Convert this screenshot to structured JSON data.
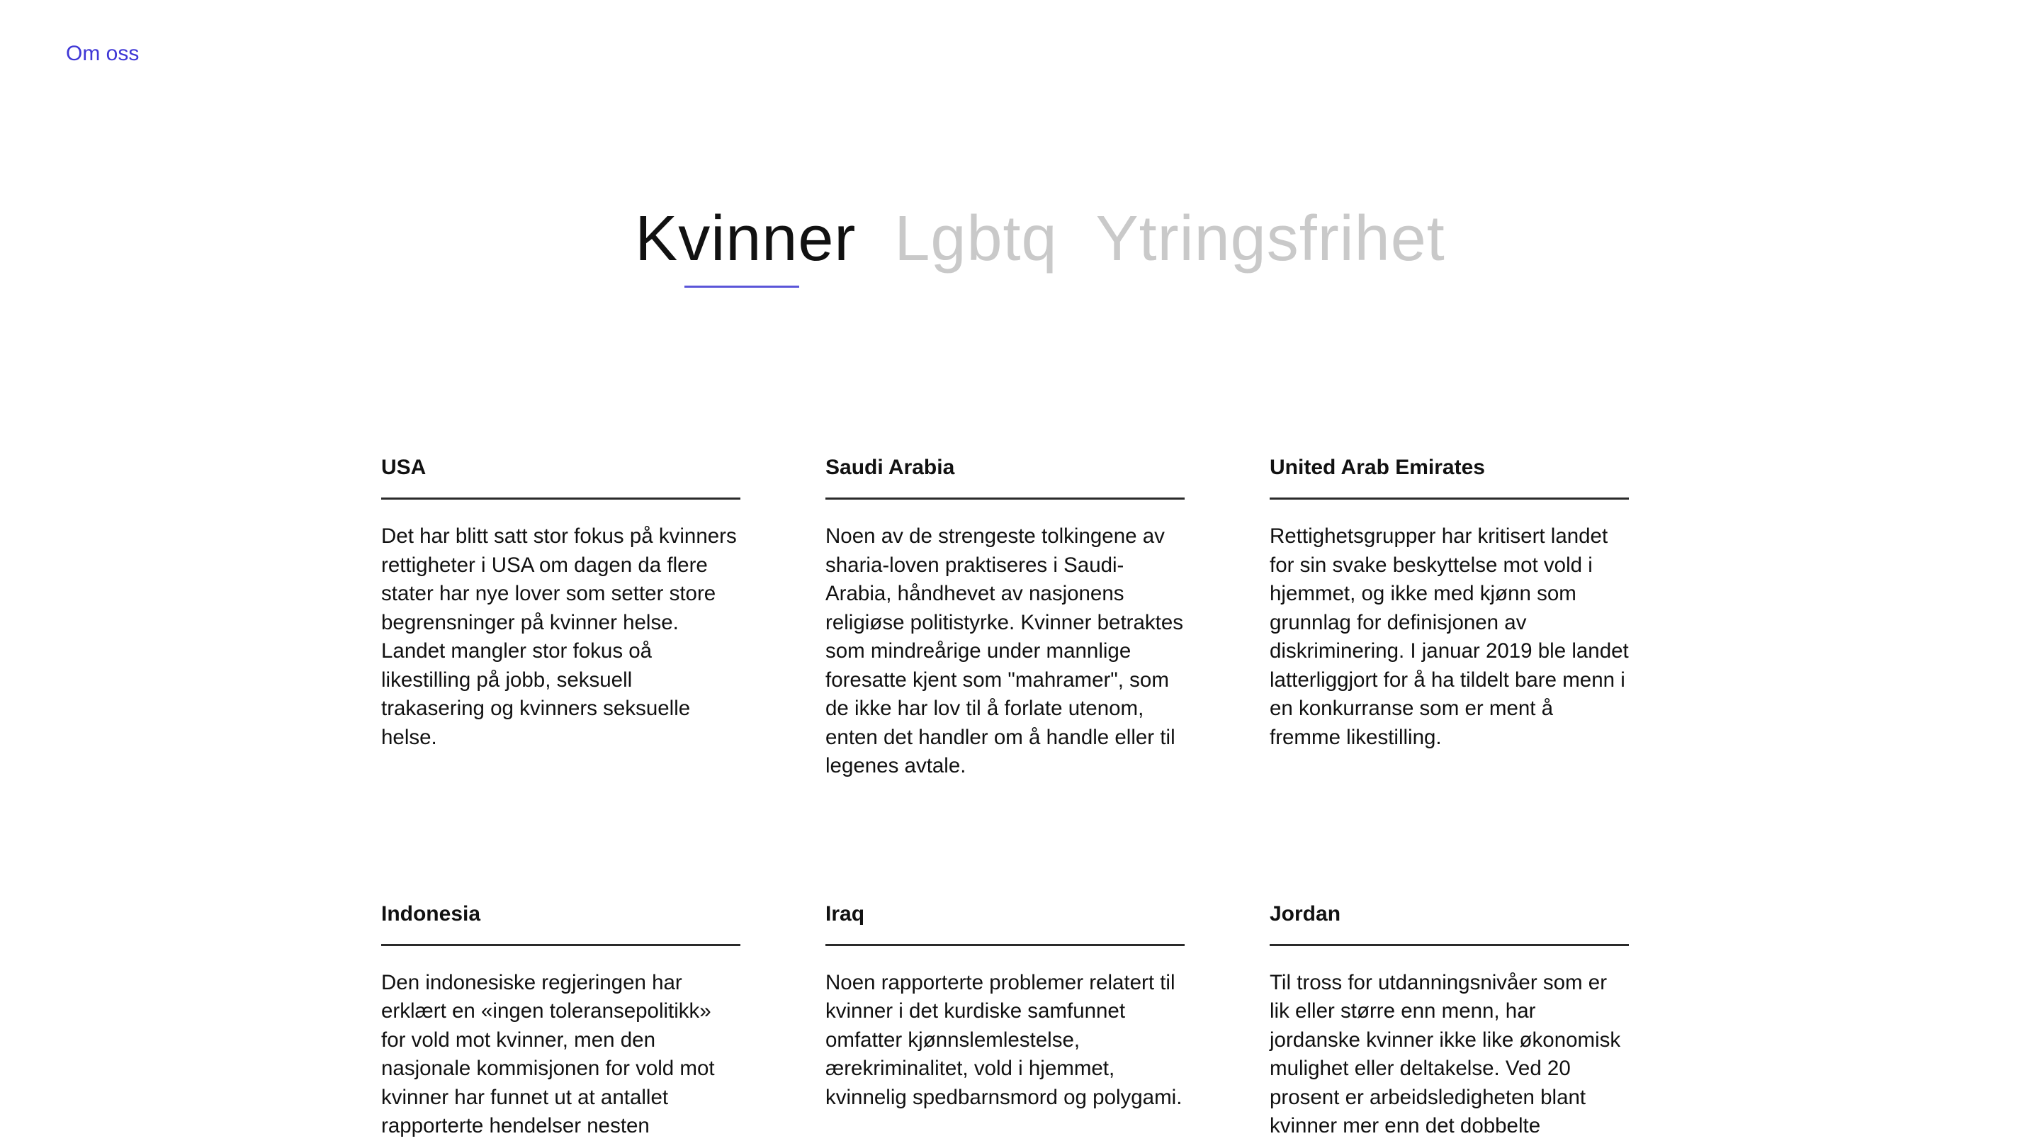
{
  "nav": {
    "about_link": "Om oss"
  },
  "tabs": [
    {
      "label": "Kvinner",
      "active": true
    },
    {
      "label": "Lgbtq",
      "active": false
    },
    {
      "label": "Ytringsfrihet",
      "active": false
    }
  ],
  "colors": {
    "accent": "#3f37d6",
    "underline": "#5a55d8",
    "inactive_tab": "#c9c9c9",
    "text": "#111111"
  },
  "countries": [
    {
      "name": "USA",
      "text": "Det har blitt satt stor fokus på kvinners rettigheter i USA om dagen da flere stater har nye lover som setter store begrensninger på kvinner helse. Landet mangler stor fokus oå likestilling på jobb, seksuell trakasering og kvinners seksuelle helse."
    },
    {
      "name": "Saudi Arabia",
      "text": "Noen av de strengeste tolkingene av sharia-loven praktiseres i Saudi-Arabia, håndhevet av nasjonens religiøse politistyrke. Kvinner betraktes som mindreårige under mannlige foresatte kjent som \"mahramer\", som de ikke har lov til å forlate utenom, enten det handler om å handle eller til legenes avtale."
    },
    {
      "name": "United Arab Emirates",
      "text": "Rettighetsgrupper har kritisert landet for sin svake beskyttelse mot vold i hjemmet, og ikke med kjønn som grunnlag for definisjonen av diskriminering. I januar 2019 ble landet latterliggjort for å ha tildelt bare menn i en konkurranse som er ment å fremme likestilling."
    },
    {
      "name": "Indonesia",
      "text": "Den indonesiske regjeringen har erklært en «ingen toleransepolitikk» for vold mot kvinner, men den nasjonale kommisjonen for vold mot kvinner har funnet ut at antallet rapporterte hendelser nesten"
    },
    {
      "name": "Iraq",
      "text": "Noen rapporterte problemer relatert til kvinner i det kurdiske samfunnet omfatter kjønnslemlestelse, ærekriminalitet, vold i hjemmet, kvinnelig spedbarnsmord og polygami."
    },
    {
      "name": "Jordan",
      "text": "Til tross for utdanningsnivåer som er lik eller større enn menn, har jordanske kvinner ikke like økonomisk mulighet eller deltakelse. Ved 20 prosent er arbeidsledigheten blant kvinner mer enn det dobbelte"
    }
  ]
}
